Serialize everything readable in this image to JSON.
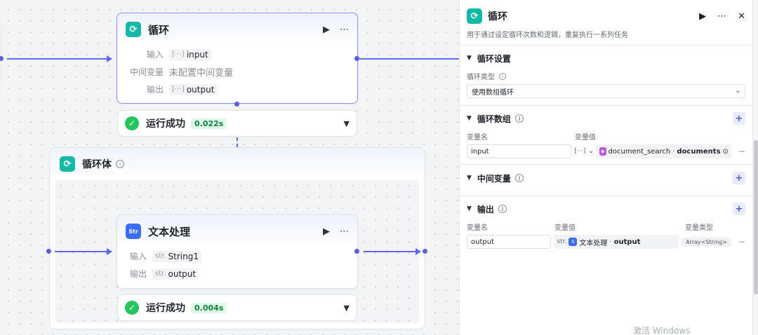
{
  "loop_node": {
    "title": "循环",
    "rows": [
      {
        "label": "输入",
        "type": "[⋯]",
        "value": "input"
      },
      {
        "label": "中间变量",
        "value": "未配置中间变量"
      },
      {
        "label": "输出",
        "type": "[⋯]",
        "value": "output"
      }
    ],
    "status": "运行成功",
    "time": "0.022s"
  },
  "loop_body": {
    "title": "循环体"
  },
  "text_node": {
    "title": "文本处理",
    "icon_text": "Str",
    "rows": [
      {
        "label": "输入",
        "type": "str.",
        "value": "String1"
      },
      {
        "label": "输出",
        "type": "str.",
        "value": "output"
      }
    ],
    "status": "运行成功",
    "time": "0.004s"
  },
  "panel": {
    "title": "循环",
    "description": "用于通过设定循环次数和逻辑，重复执行一系列任务",
    "loop_settings": {
      "title": "循环设置",
      "type_label": "循环类型",
      "type_value": "使用数组循环"
    },
    "loop_array": {
      "title": "循环数组",
      "col_name": "变量名",
      "col_value": "变量值",
      "name": "input",
      "type": "[⋯]",
      "ref_node": "document_search",
      "ref_sep": "·",
      "ref_field": "documents"
    },
    "intermediate": {
      "title": "中间变量"
    },
    "output": {
      "title": "输出",
      "col_name": "变量名",
      "col_value": "变量值",
      "col_type": "变量类型",
      "name": "output",
      "type": "str.",
      "ref_node": "文本处理",
      "ref_sep": "·",
      "ref_field": "output",
      "var_type": "Array<String>"
    }
  },
  "watermark": "激活 Windows",
  "colors": {
    "accent": "#6366f1",
    "teal_icon": "#14b8a6",
    "blue_icon": "#3b6cf6",
    "success": "#22c55e"
  }
}
